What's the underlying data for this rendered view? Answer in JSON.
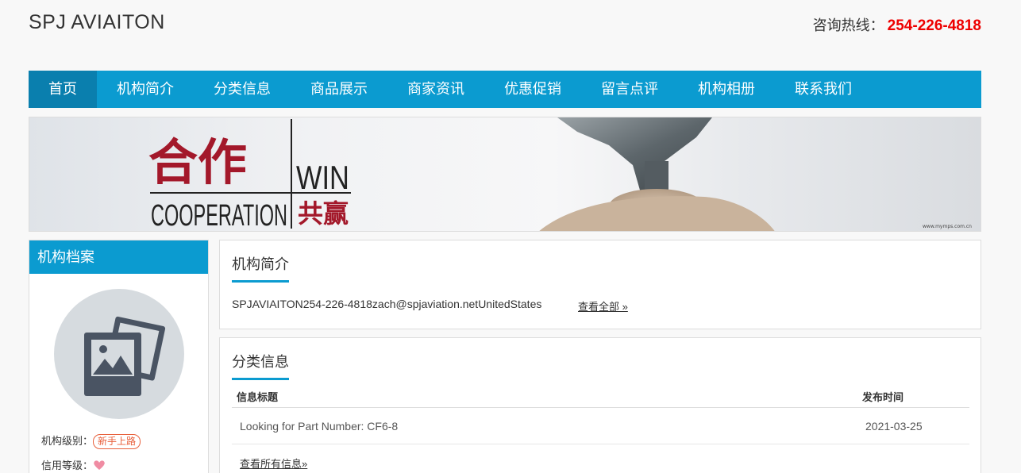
{
  "header": {
    "site_title": "SPJ AVIAITON",
    "hotline_label": "咨询热线：",
    "hotline_number": "254-226-4818"
  },
  "nav": {
    "items": [
      "首页",
      "机构简介",
      "分类信息",
      "商品展示",
      "商家资讯",
      "优惠促销",
      "留言点评",
      "机构相册",
      "联系我们"
    ],
    "active_index": 0
  },
  "banner": {
    "chinese_title": "合作",
    "word_win": "WIN",
    "word_cooperation": "COOPERATION",
    "chinese_subtitle": "共赢",
    "watermark": "www.mymps.com.cn"
  },
  "sidebar": {
    "title": "机构档案",
    "level_label": "机构级别：",
    "level_value": "新手上路",
    "credit_label": "信用等级：",
    "credit_icon": "heart-icon"
  },
  "intro": {
    "title": "机构简介",
    "text": "SPJAVIAITON254-226-4818zach@spjaviation.netUnitedStates",
    "view_all": "查看全部 »"
  },
  "category": {
    "title": "分类信息",
    "col_title": "信息标题",
    "col_date": "发布时间",
    "rows": [
      {
        "title": "Looking for Part Number: CF6-8",
        "date": "2021-03-25"
      }
    ],
    "view_all": "查看所有信息»"
  },
  "colors": {
    "accent": "#0b9bd0",
    "nav_active": "#0a7fae",
    "hotline": "#ee0000",
    "badge": "#e8603c"
  }
}
